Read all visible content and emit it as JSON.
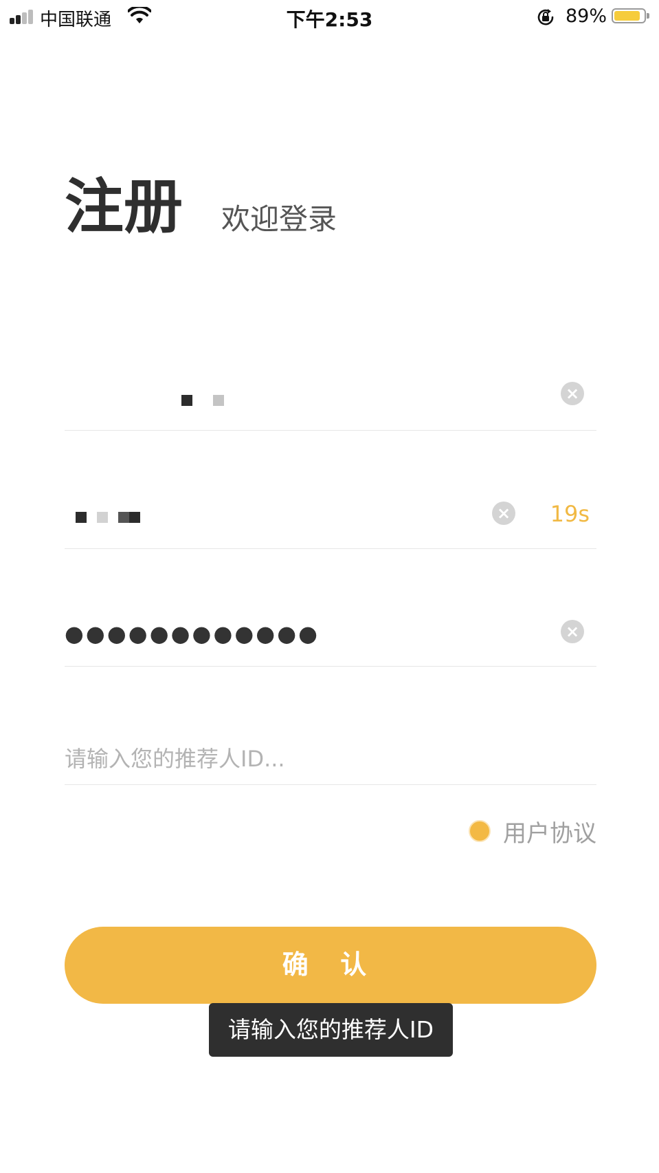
{
  "status_bar": {
    "carrier": "中国联通",
    "time": "下午2:53",
    "battery_percent": "89%",
    "battery_level": 0.89,
    "signal_bars": 2,
    "icons": [
      "signal-icon",
      "wifi-icon",
      "rotation-lock-icon",
      "battery-icon"
    ]
  },
  "header": {
    "title": "注册",
    "subtitle": "欢迎登录"
  },
  "form": {
    "phone": {
      "value_masked": true,
      "clear_icon": "clear-icon"
    },
    "code": {
      "value_masked": true,
      "countdown": "19s",
      "clear_icon": "clear-icon"
    },
    "password": {
      "value": "●●●●●●●●●●●●",
      "clear_icon": "clear-icon"
    },
    "referrer": {
      "placeholder": "请输入您的推荐人ID..."
    }
  },
  "agreement": {
    "label": "用户协议",
    "checked": true
  },
  "confirm_button": {
    "label": "确 认"
  },
  "toast": {
    "message": "请输入您的推荐人ID"
  },
  "colors": {
    "accent": "#f2b846",
    "countdown": "#f1b944",
    "toast_bg": "#2f2f2f",
    "placeholder": "#b3b3b3"
  }
}
